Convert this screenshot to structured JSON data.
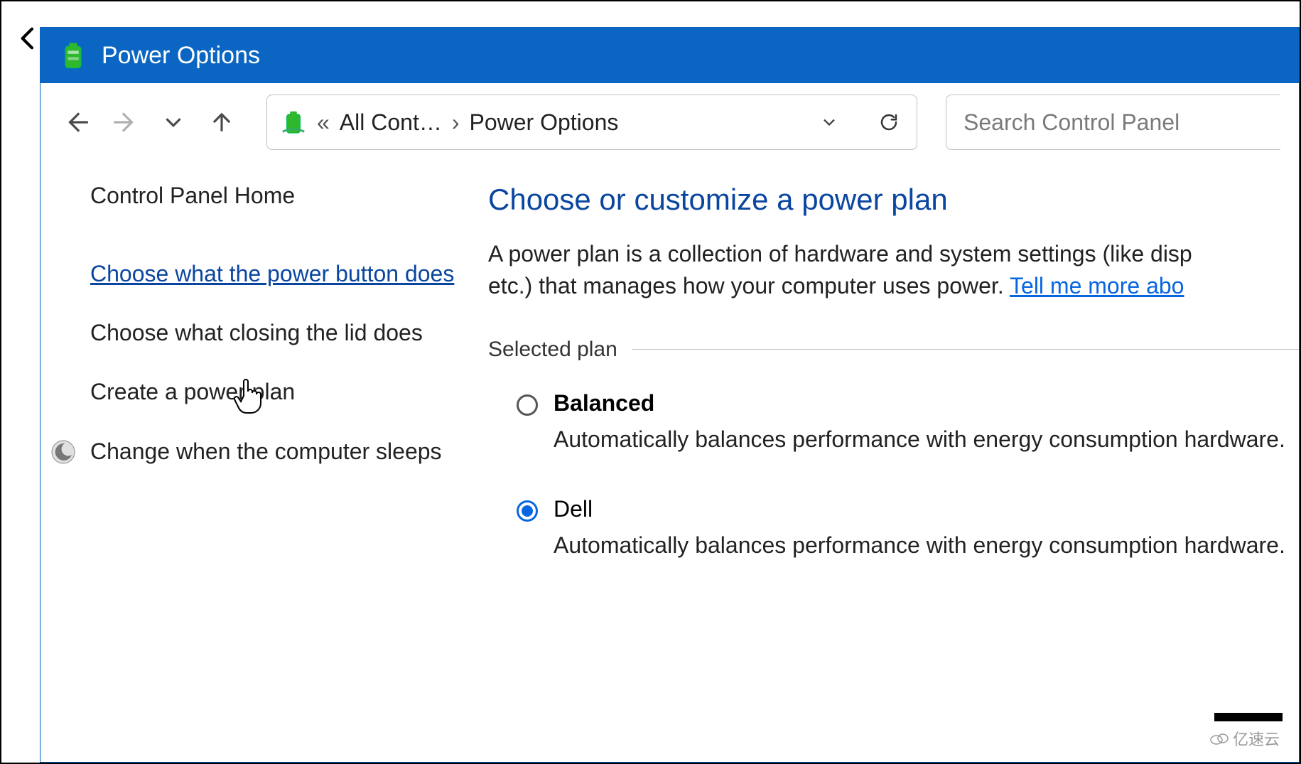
{
  "window": {
    "title": "Power Options"
  },
  "address": {
    "crumb_prefix": "«",
    "crumb1": "All Cont…",
    "sep": "›",
    "crumb2": "Power Options"
  },
  "search": {
    "placeholder": "Search Control Panel"
  },
  "sidebar": {
    "home": "Control Panel Home",
    "links": [
      {
        "label": "Choose what the power button does"
      },
      {
        "label": "Choose what closing the lid does"
      },
      {
        "label": "Create a power plan"
      },
      {
        "label": "Change when the computer sleeps"
      }
    ]
  },
  "main": {
    "heading": "Choose or customize a power plan",
    "desc_part1": "A power plan is a collection of hardware and system settings (like disp",
    "desc_part2": "etc.) that manages how your computer uses power. ",
    "desc_link": "Tell me more abo",
    "section_label": "Selected plan",
    "plans": [
      {
        "name": "Balanced",
        "selected": false,
        "bold": true,
        "desc": "Automatically balances performance with energy consumption hardware."
      },
      {
        "name": "Dell",
        "selected": true,
        "bold": false,
        "desc": "Automatically balances performance with energy consumption hardware."
      }
    ]
  },
  "watermark": "亿速云"
}
